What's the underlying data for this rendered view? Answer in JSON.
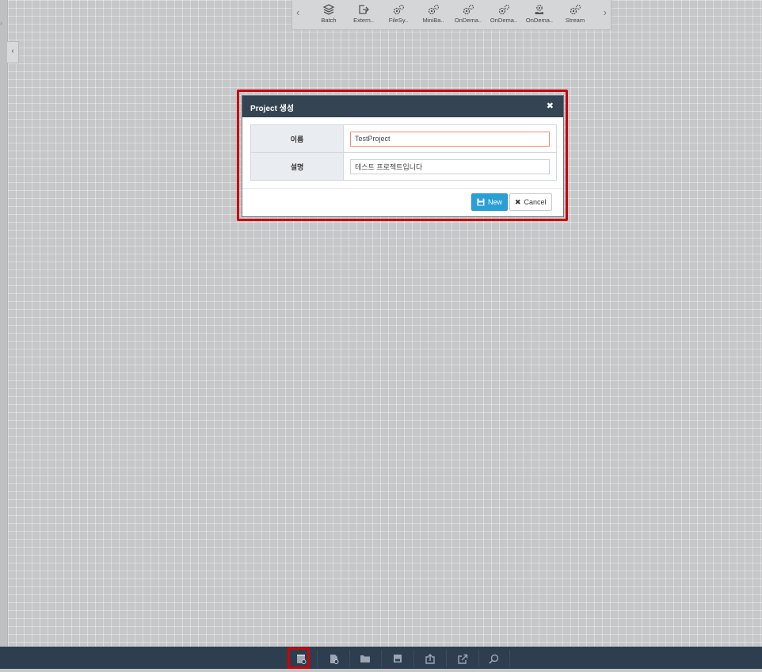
{
  "palette": {
    "prev_icon": "chevron-left-icon",
    "next_icon": "chevron-right-icon",
    "items": [
      {
        "label": "Batch",
        "icon": "layers-icon"
      },
      {
        "label": "Extern..",
        "icon": "external-link-icon"
      },
      {
        "label": "FileSy..",
        "icon": "gears-icon"
      },
      {
        "label": "MiniBa..",
        "icon": "gears-icon"
      },
      {
        "label": "OnDema..",
        "icon": "gears-icon"
      },
      {
        "label": "OnDema..",
        "icon": "gears-icon"
      },
      {
        "label": "OnDema..",
        "icon": "gear-hand-icon"
      },
      {
        "label": "Stream",
        "icon": "gears-icon"
      }
    ]
  },
  "sidebar": {
    "collapse_label": "‹"
  },
  "modal": {
    "title": "Project 생성",
    "close_label": "✖",
    "fields": [
      {
        "label": "이름",
        "value": "TestProject"
      },
      {
        "label": "설명",
        "value": "테스트 프로젝트입니다"
      }
    ],
    "new_label": "New",
    "cancel_label": "Cancel"
  },
  "bottom_toolbar": {
    "buttons": [
      {
        "icon": "new-project-icon",
        "highlighted": true
      },
      {
        "icon": "file-info-icon"
      },
      {
        "icon": "folder-icon"
      },
      {
        "icon": "save-icon"
      },
      {
        "icon": "import-icon"
      },
      {
        "icon": "export-icon"
      },
      {
        "icon": "search-icon"
      }
    ]
  },
  "colors": {
    "header": "#344453",
    "primary_button": "#2a9fd6",
    "highlight": "#c8050a",
    "bottom_bar": "#2d3e4e"
  }
}
